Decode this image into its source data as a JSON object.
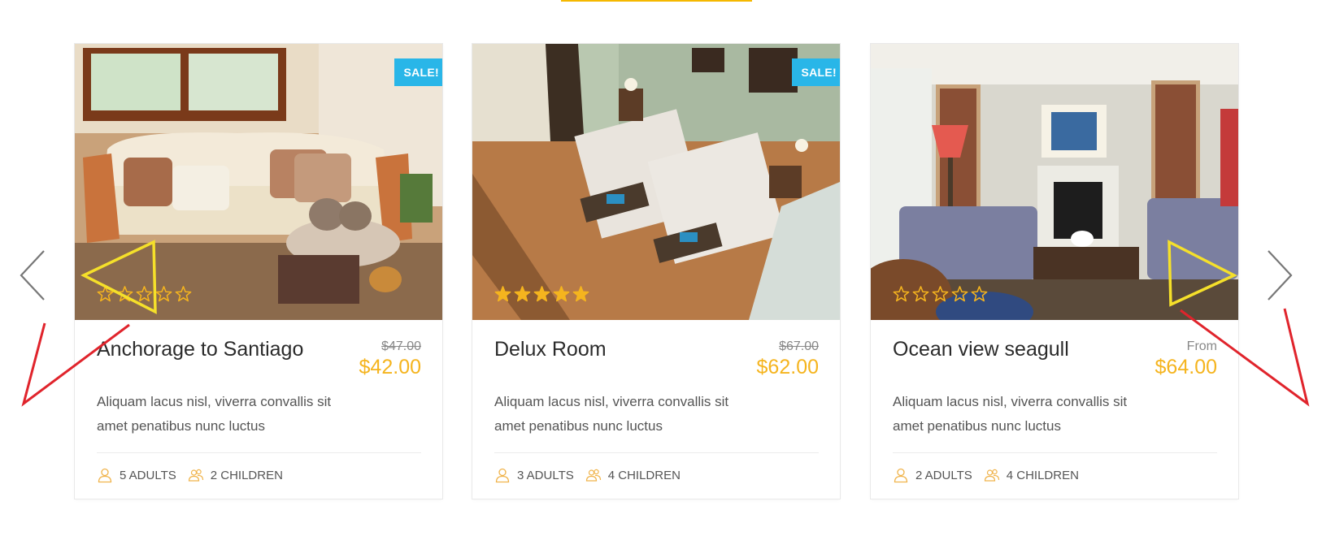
{
  "accent_color": "#f5b800",
  "sale_badge_color": "#29b6e8",
  "price_color": "#f5b41e",
  "carousel": {
    "prev_icon": "chevron-left-icon",
    "next_icon": "chevron-right-icon"
  },
  "rooms": [
    {
      "title": "Anchorage to Santiago",
      "sale": "SALE!",
      "rating": 0,
      "rating_max": 5,
      "price_old": "$47.00",
      "price_label": "",
      "price": "$42.00",
      "description": "Aliquam lacus nisl, viverra convallis sit amet penatibus nunc luctus",
      "adults": "5 ADULTS",
      "children": "2 CHILDREN"
    },
    {
      "title": "Delux Room",
      "sale": "SALE!",
      "rating": 5,
      "rating_max": 5,
      "price_old": "$67.00",
      "price_label": "",
      "price": "$62.00",
      "description": "Aliquam lacus nisl, viverra convallis sit amet penatibus nunc luctus",
      "adults": "3 ADULTS",
      "children": "4 CHILDREN"
    },
    {
      "title": "Ocean view seagull",
      "sale": "",
      "rating": 0,
      "rating_max": 5,
      "price_old": "",
      "price_label": "From",
      "price": "$64.00",
      "description": "Aliquam lacus nisl, viverra convallis sit amet penatibus nunc luctus",
      "adults": "2 ADULTS",
      "children": "4 CHILDREN"
    }
  ]
}
